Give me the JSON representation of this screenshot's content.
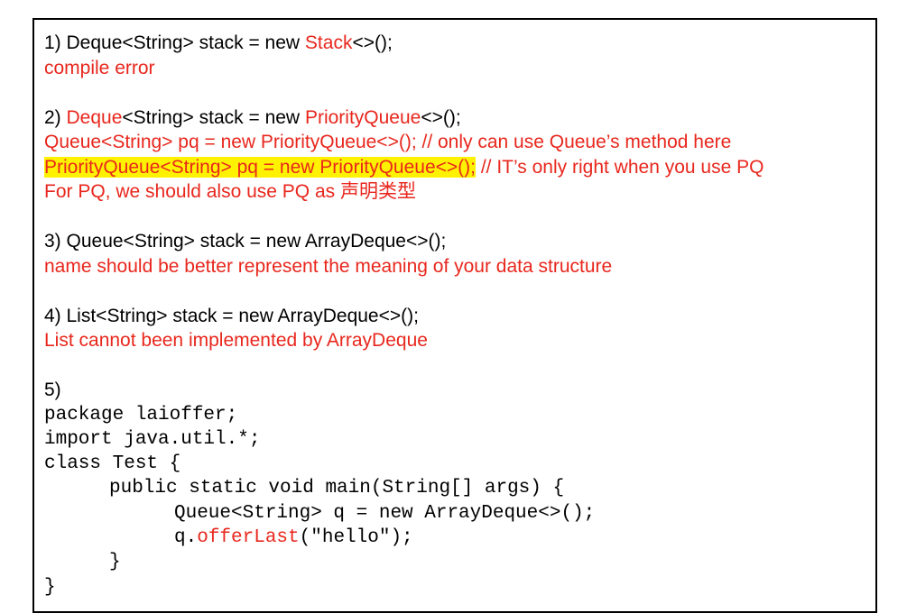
{
  "q1": {
    "p1": "1) Deque<String> stack = new ",
    "p2": "Stack",
    "p3": "<>();",
    "note": "compile error"
  },
  "q2": {
    "p1": "2) ",
    "p2": "Deque",
    "p3": "<String> stack = new ",
    "p4": "PriorityQueue",
    "p5": "<>();",
    "line2": "Queue<String> pq = new PriorityQueue<>(); // only can use Queue’s method here",
    "line3_highlight": "PriorityQueue<String> pq = new PriorityQueue<>();",
    "line3_rest": " // IT’s only right when you use PQ",
    "line4": "For PQ, we should also use PQ as 声明类型"
  },
  "q3": {
    "code": "3) Queue<String> stack = new ArrayDeque<>();",
    "note": "name should be better represent the meaning of your data structure"
  },
  "q4": {
    "code": "4) List<String> stack = new ArrayDeque<>();",
    "note": "List cannot been implemented by ArrayDeque"
  },
  "q5": {
    "label": "5)",
    "code_lines": {
      "l1": "package laioffer;",
      "l2": "import java.util.*;",
      "l3": "class Test {",
      "l4": "public static void main(String[] args) {",
      "l5": "Queue<String> q = new ArrayDeque<>();",
      "l6a": "q.",
      "l6b": "offerLast",
      "l6c": "(\"hello\");",
      "l7": "}",
      "l8": "}"
    }
  },
  "colors": {
    "annotation": "#e8271d",
    "highlight": "#fff200",
    "text": "#000000"
  }
}
